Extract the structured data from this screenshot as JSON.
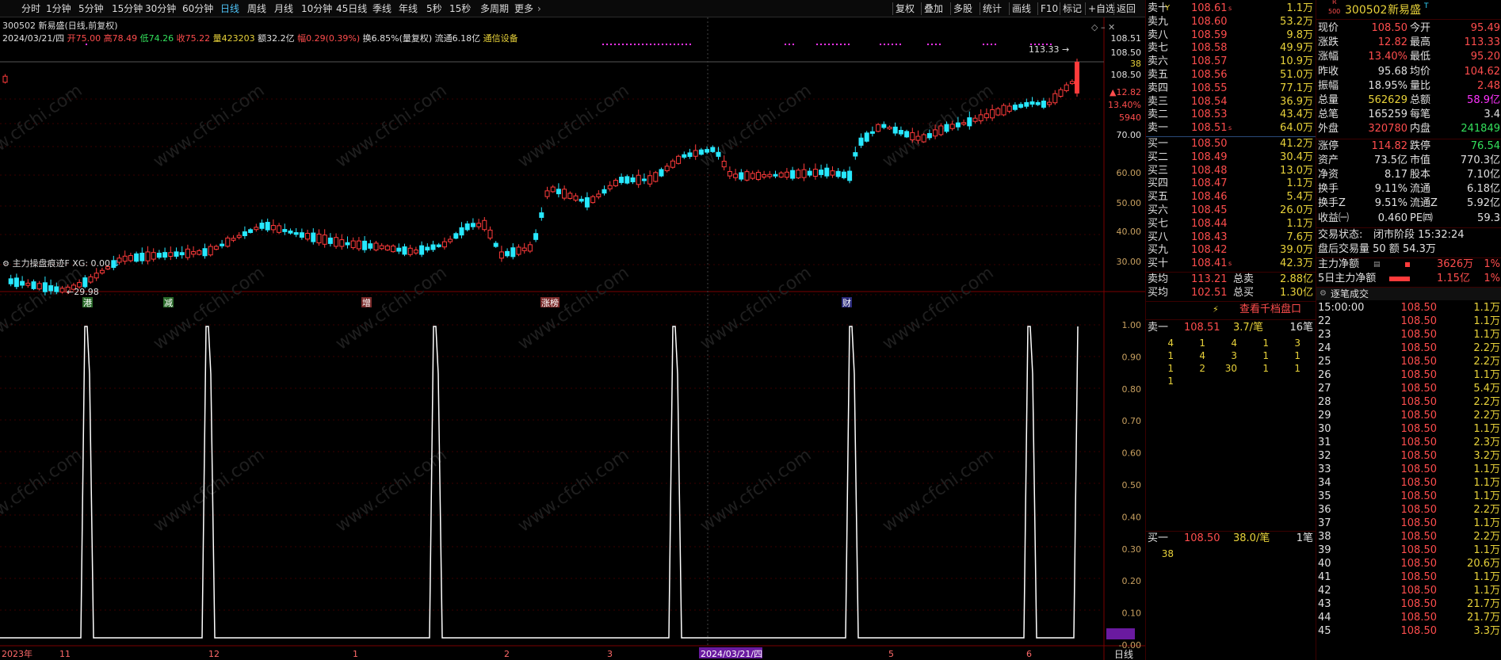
{
  "toolbar": {
    "periods": [
      "分时",
      "1分钟",
      "5分钟",
      "15分钟",
      "30分钟",
      "60分钟",
      "日线",
      "周线",
      "月线",
      "10分钟",
      "45日线",
      "季线",
      "年线",
      "5秒",
      "15秒",
      "多周期",
      "更多"
    ],
    "active_period": "日线",
    "right_tools": [
      "复权",
      "叠加",
      "多股",
      "统计",
      "画线",
      "F10",
      "标记",
      "+自选",
      "返回"
    ]
  },
  "chart": {
    "title": "300502 新易盛(日线,前复权)",
    "info_date": "2024/03/21/四",
    "info_open": "开75.00",
    "info_high": "高78.49",
    "info_low": "低74.26",
    "info_close": "收75.22",
    "info_volume": "量423203",
    "info_amount": "额32.2亿",
    "info_change": "幅0.29(0.39%)",
    "info_turnover": "换6.85%(量复权)",
    "info_float": "流通6.18亿",
    "info_sector": "通信设备",
    "max_label": "113.33",
    "min_label": "29.98",
    "price_axis": [
      "108.51",
      "108.50",
      "38",
      "108.50",
      "▲12.82",
      "13.40%",
      "5940",
      "70.00",
      "60.00",
      "50.00",
      "40.00",
      "30.00"
    ],
    "event_tags": [
      "港",
      "减",
      "增",
      "涨榜",
      "财"
    ],
    "indicator_title": "主力操盘痕迹F",
    "indicator_value": "XG: 0.00",
    "indicator_axis": [
      "1.00",
      "0.90",
      "0.80",
      "0.70",
      "0.60",
      "0.50",
      "0.40",
      "0.30",
      "0.20",
      "0.10",
      "-0.00"
    ],
    "time_axis": [
      "2023年",
      "11",
      "12",
      "1",
      "2",
      "3",
      "2024/03/21/四",
      "5",
      "6"
    ],
    "period_label": "日线",
    "watermark": "www.cfchi.com"
  },
  "orderbook": {
    "asks": [
      {
        "label": "卖十",
        "flag": "Y",
        "price": "108.61",
        "mark": "s",
        "vol": "1.1万"
      },
      {
        "label": "卖九",
        "price": "108.60",
        "vol": "53.2万"
      },
      {
        "label": "卖八",
        "price": "108.59",
        "vol": "9.8万"
      },
      {
        "label": "卖七",
        "price": "108.58",
        "vol": "49.9万"
      },
      {
        "label": "卖六",
        "price": "108.57",
        "vol": "10.9万"
      },
      {
        "label": "卖五",
        "price": "108.56",
        "vol": "51.0万"
      },
      {
        "label": "卖四",
        "price": "108.55",
        "vol": "77.1万"
      },
      {
        "label": "卖三",
        "price": "108.54",
        "vol": "36.9万"
      },
      {
        "label": "卖二",
        "price": "108.53",
        "vol": "43.4万"
      },
      {
        "label": "卖一",
        "price": "108.51",
        "mark": "s",
        "vol": "64.0万"
      }
    ],
    "bids": [
      {
        "label": "买一",
        "price": "108.50",
        "vol": "41.2万"
      },
      {
        "label": "买二",
        "price": "108.49",
        "vol": "30.4万"
      },
      {
        "label": "买三",
        "price": "108.48",
        "vol": "13.0万"
      },
      {
        "label": "买四",
        "price": "108.47",
        "vol": "1.1万"
      },
      {
        "label": "买五",
        "price": "108.46",
        "vol": "5.4万"
      },
      {
        "label": "买六",
        "price": "108.45",
        "vol": "26.0万"
      },
      {
        "label": "买七",
        "price": "108.44",
        "vol": "1.1万"
      },
      {
        "label": "买八",
        "price": "108.43",
        "vol": "7.6万"
      },
      {
        "label": "买九",
        "price": "108.42",
        "vol": "39.0万"
      },
      {
        "label": "买十",
        "price": "108.41",
        "mark": "s",
        "vol": "42.3万"
      }
    ],
    "sell_avg_label": "卖均",
    "sell_avg": "113.21",
    "sell_total_label": "总卖",
    "sell_total": "2.88亿",
    "buy_avg_label": "买均",
    "buy_avg": "102.51",
    "buy_total_label": "总买",
    "buy_total": "1.30亿",
    "thousand_link": "查看千档盘口",
    "ask1_label": "卖一",
    "ask1_price": "108.51",
    "ask1_per": "3.7/笔",
    "ask1_count": "16笔",
    "ask1_queue": [
      [
        "4",
        "1",
        "4",
        "1",
        "3"
      ],
      [
        "1",
        "4",
        "3",
        "1",
        "1"
      ],
      [
        "1",
        "2",
        "30",
        "1",
        "1"
      ],
      [
        "1",
        "",
        "",
        "",
        ""
      ]
    ],
    "bid1_label": "买一",
    "bid1_price": "108.50",
    "bid1_per": "38.0/笔",
    "bid1_count": "1笔",
    "bid1_queue": [
      "38"
    ]
  },
  "quote": {
    "badge_top": "R",
    "badge_bottom": "500",
    "code": "300502",
    "name": "新易盛",
    "tag": "T",
    "rows": [
      {
        "l1": "现价",
        "v1": "108.50",
        "c1": "red",
        "l2": "今开",
        "v2": "95.49",
        "c2": "red"
      },
      {
        "l1": "涨跌",
        "v1": "12.82",
        "c1": "red",
        "l2": "最高",
        "v2": "113.33",
        "c2": "red"
      },
      {
        "l1": "涨幅",
        "v1": "13.40%",
        "c1": "red",
        "l2": "最低",
        "v2": "95.20",
        "c2": "red"
      },
      {
        "l1": "昨收",
        "v1": "95.68",
        "c1": "white",
        "l2": "均价",
        "v2": "104.62",
        "c2": "red"
      },
      {
        "l1": "振幅",
        "v1": "18.95%",
        "c1": "white",
        "l2": "量比",
        "v2": "2.48",
        "c2": "red"
      },
      {
        "l1": "总量",
        "v1": "562629",
        "c1": "yellow",
        "l2": "总额",
        "v2": "58.9亿",
        "c2": "magenta"
      },
      {
        "l1": "总笔",
        "v1": "165259",
        "c1": "white",
        "l2": "每笔",
        "v2": "3.4",
        "c2": "white"
      },
      {
        "l1": "外盘",
        "v1": "320780",
        "c1": "red",
        "l2": "内盘",
        "v2": "241849",
        "c2": "green"
      }
    ],
    "rows2": [
      {
        "l1": "涨停",
        "v1": "114.82",
        "c1": "red",
        "l2": "跌停",
        "v2": "76.54",
        "c2": "green"
      },
      {
        "l1": "资产",
        "v1": "73.5亿",
        "c1": "white",
        "l2": "市值",
        "v2": "770.3亿",
        "c2": "white"
      },
      {
        "l1": "净资",
        "v1": "8.17",
        "c1": "white",
        "l2": "股本",
        "v2": "7.10亿",
        "c2": "white"
      },
      {
        "l1": "换手",
        "v1": "9.11%",
        "c1": "white",
        "l2": "流通",
        "v2": "6.18亿",
        "c2": "white"
      },
      {
        "l1": "换手Z",
        "v1": "9.51%",
        "c1": "white",
        "l2": "流通Z",
        "v2": "5.92亿",
        "c2": "white"
      },
      {
        "l1": "收益㈠",
        "v1": "0.460",
        "c1": "white",
        "l2": "PE㈣",
        "v2": "59.3",
        "c2": "white"
      }
    ],
    "status_label": "交易状态:",
    "status_value": "闭市阶段 15:32:24",
    "after_hours": "盘后交易量 50 额 54.3万",
    "main_flow_label": "主力净额",
    "main_flow_value": "3626万",
    "main_flow_pct": "1%",
    "main_flow5_label": "5日主力净额",
    "main_flow5_value": "1.15亿",
    "main_flow5_pct": "1%",
    "ticks_title": "逐笔成交",
    "ticks": [
      {
        "t": "15:00:00",
        "p": "108.50",
        "v": "1.1万"
      },
      {
        "t": "22",
        "p": "108.50",
        "v": "1.1万"
      },
      {
        "t": "23",
        "p": "108.50",
        "v": "1.1万"
      },
      {
        "t": "24",
        "p": "108.50",
        "v": "2.2万"
      },
      {
        "t": "25",
        "p": "108.50",
        "v": "2.2万"
      },
      {
        "t": "26",
        "p": "108.50",
        "v": "1.1万"
      },
      {
        "t": "27",
        "p": "108.50",
        "v": "5.4万"
      },
      {
        "t": "28",
        "p": "108.50",
        "v": "2.2万"
      },
      {
        "t": "29",
        "p": "108.50",
        "v": "2.2万"
      },
      {
        "t": "30",
        "p": "108.50",
        "v": "1.1万"
      },
      {
        "t": "31",
        "p": "108.50",
        "v": "2.3万"
      },
      {
        "t": "32",
        "p": "108.50",
        "v": "3.2万"
      },
      {
        "t": "33",
        "p": "108.50",
        "v": "1.1万"
      },
      {
        "t": "34",
        "p": "108.50",
        "v": "1.1万"
      },
      {
        "t": "35",
        "p": "108.50",
        "v": "1.1万"
      },
      {
        "t": "36",
        "p": "108.50",
        "v": "2.2万"
      },
      {
        "t": "37",
        "p": "108.50",
        "v": "1.1万"
      },
      {
        "t": "38",
        "p": "108.50",
        "v": "2.2万"
      },
      {
        "t": "39",
        "p": "108.50",
        "v": "1.1万"
      },
      {
        "t": "40",
        "p": "108.50",
        "v": "20.6万"
      },
      {
        "t": "41",
        "p": "108.50",
        "v": "1.1万"
      },
      {
        "t": "42",
        "p": "108.50",
        "v": "1.1万"
      },
      {
        "t": "43",
        "p": "108.50",
        "v": "21.7万"
      },
      {
        "t": "44",
        "p": "108.50",
        "v": "21.7万"
      },
      {
        "t": "45",
        "p": "108.50",
        "v": "3.3万"
      }
    ]
  }
}
